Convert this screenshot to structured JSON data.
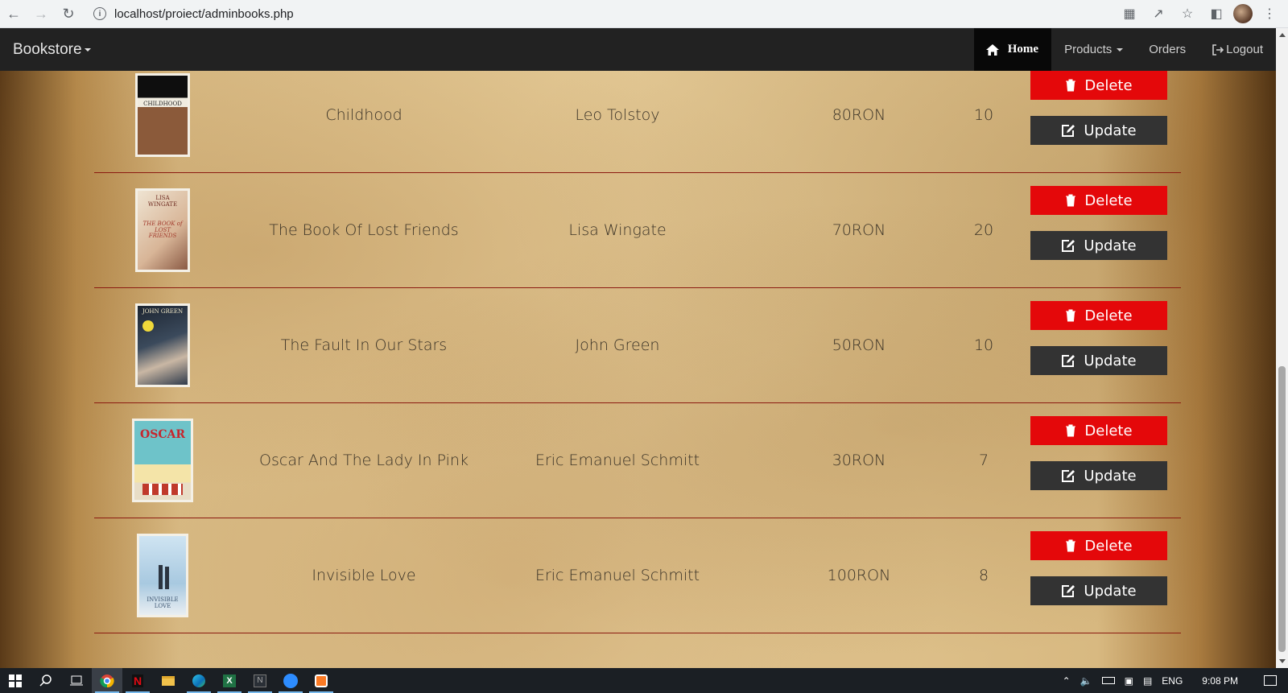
{
  "browser": {
    "url": "localhost/proiect/adminbooks.php"
  },
  "navbar": {
    "brand": "Bookstore",
    "home": "Home",
    "products": "Products",
    "orders": "Orders",
    "logout": "Logout"
  },
  "books": [
    {
      "title": "Childhood",
      "author": "Leo Tolstoy",
      "price": "80RON",
      "qty": "10",
      "delete": "Delete",
      "update": "Update"
    },
    {
      "title": "The Book Of Lost Friends",
      "author": "Lisa Wingate",
      "price": "70RON",
      "qty": "20",
      "delete": "Delete",
      "update": "Update"
    },
    {
      "title": "The Fault In Our Stars",
      "author": "John Green",
      "price": "50RON",
      "qty": "10",
      "delete": "Delete",
      "update": "Update"
    },
    {
      "title": "Oscar And The Lady In Pink",
      "author": "Eric Emanuel Schmitt",
      "price": "30RON",
      "qty": "7",
      "delete": "Delete",
      "update": "Update"
    },
    {
      "title": "Invisible Love",
      "author": "Eric Emanuel Schmitt",
      "price": "100RON",
      "qty": "8",
      "delete": "Delete",
      "update": "Update"
    }
  ],
  "covers": {
    "childhood": "CHILDHOOD",
    "wingate_author": "LISA WINGATE",
    "wingate_title": "THE BOOK of LOST FRIENDS",
    "green_author": "JOHN GREEN",
    "oscar": "OSCAR",
    "invisible": "INVISIBLE LOVE"
  },
  "taskbar": {
    "lang": "ENG",
    "time": "9:08 PM"
  },
  "colors": {
    "delete": "#e4080a",
    "update": "#333333",
    "navbar": "#222222",
    "row_border": "#8b1a10"
  }
}
